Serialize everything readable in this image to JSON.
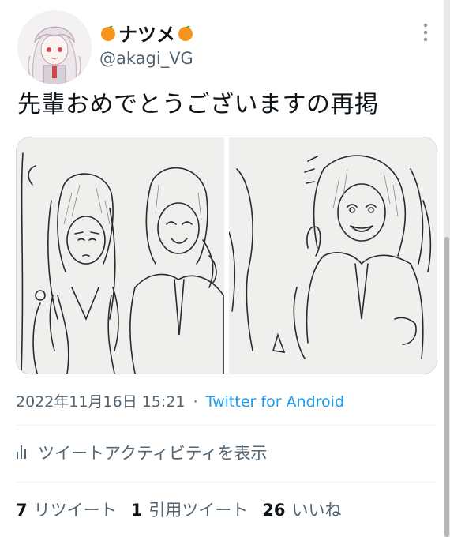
{
  "author": {
    "display_name": "ナツメ",
    "name_emoji": "orange-emoji",
    "handle": "@akagi_VG"
  },
  "tweet": {
    "text": "先輩おめでとうございますの再掲"
  },
  "media": [
    {
      "name": "sketch-two-girls"
    },
    {
      "name": "sketch-smiling-character"
    }
  ],
  "meta": {
    "timestamp": "2022年11月16日 15:21",
    "separator": "·",
    "source": "Twitter for Android"
  },
  "activity": {
    "label": "ツイートアクティビティを表示",
    "icon": "bar-chart-icon"
  },
  "stats": {
    "retweets_count": "7",
    "retweets_label": "リツイート",
    "quotes_count": "1",
    "quotes_label": "引用ツイート",
    "likes_count": "26",
    "likes_label": "いいね"
  },
  "colors": {
    "text": "#0f1419",
    "secondary": "#536471",
    "link": "#1d9bf0",
    "orange": "#f7941d"
  }
}
